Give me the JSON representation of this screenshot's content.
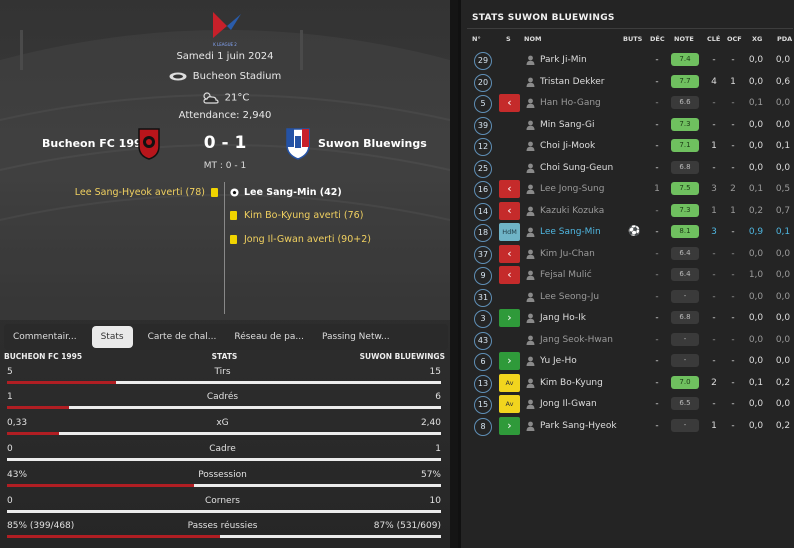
{
  "match": {
    "date": "Samedi 1 juin 2024",
    "stadium": "Bucheon Stadium",
    "temperature": "21°C",
    "attendance": "Attendance: 2,940",
    "home_team": "Bucheon FC 1995",
    "away_team": "Suwon Bluewings",
    "score": "0 - 1",
    "halftime": "MT : 0 - 1",
    "league_logo_text": "K LEAGUE 2"
  },
  "events": {
    "home": [
      {
        "text": "Lee Sang-Hyeok averti (78)",
        "type": "yellow"
      }
    ],
    "away": [
      {
        "text": "Lee Sang-Min (42)",
        "type": "goal"
      },
      {
        "text": "Kim Bo-Kyung averti (76)",
        "type": "yellow"
      },
      {
        "text": "Jong Il-Gwan averti (90+2)",
        "type": "yellow"
      }
    ]
  },
  "tabs": [
    "Commentair...",
    "Stats",
    "Carte de chal...",
    "Réseau de pa...",
    "Passing Netw..."
  ],
  "active_tab": "Stats",
  "stats_header": {
    "home": "BUCHEON FC 1995",
    "center": "STATS",
    "away": "SUWON BLUEWINGS"
  },
  "stats": [
    {
      "label": "Tirs",
      "home": "5",
      "away": "15",
      "home_share": 0.25
    },
    {
      "label": "Cadrés",
      "home": "1",
      "away": "6",
      "home_share": 0.143
    },
    {
      "label": "xG",
      "home": "0,33",
      "away": "2,40",
      "home_share": 0.12
    },
    {
      "label": "Cadre",
      "home": "0",
      "away": "1",
      "home_share": 0.0
    },
    {
      "label": "Possession",
      "home": "43%",
      "away": "57%",
      "home_share": 0.43
    },
    {
      "label": "Corners",
      "home": "0",
      "away": "10",
      "home_share": 0.0
    },
    {
      "label": "Passes réussies",
      "home": "85% (399/468)",
      "away": "87% (531/609)",
      "home_share": 0.49
    }
  ],
  "right_panel": {
    "title": "STATS SUWON BLUEWINGS",
    "columns": [
      "N°",
      "S",
      "NOM",
      "BUTS",
      "DÉC",
      "NOTE",
      "CLÉ",
      "OCF",
      "XG",
      "PDA"
    ]
  },
  "players": [
    {
      "num": "29",
      "sub": "",
      "name": "Park Ji-Min",
      "goals": "",
      "dec": "-",
      "rating": "7.4",
      "rating_color": "green",
      "key": "-",
      "ocf": "-",
      "xg": "0,0",
      "pda": "0,0",
      "dim": false
    },
    {
      "num": "20",
      "sub": "",
      "name": "Tristan Dekker",
      "goals": "",
      "dec": "-",
      "rating": "7.7",
      "rating_color": "green",
      "key": "4",
      "ocf": "1",
      "xg": "0,0",
      "pda": "0,6",
      "dim": false
    },
    {
      "num": "5",
      "sub": "out",
      "name": "Han Ho-Gang",
      "goals": "",
      "dec": "-",
      "rating": "6.6",
      "rating_color": "grey",
      "key": "-",
      "ocf": "-",
      "xg": "0,1",
      "pda": "0,0",
      "dim": true
    },
    {
      "num": "39",
      "sub": "",
      "name": "Min Sang-Gi",
      "goals": "",
      "dec": "-",
      "rating": "7.3",
      "rating_color": "green",
      "key": "-",
      "ocf": "-",
      "xg": "0,0",
      "pda": "0,0",
      "dim": false
    },
    {
      "num": "12",
      "sub": "",
      "name": "Choi Ji-Mook",
      "goals": "",
      "dec": "-",
      "rating": "7.1",
      "rating_color": "green",
      "key": "1",
      "ocf": "-",
      "xg": "0,0",
      "pda": "0,1",
      "dim": false
    },
    {
      "num": "25",
      "sub": "",
      "name": "Choi Sung-Geun",
      "goals": "",
      "dec": "-",
      "rating": "6.8",
      "rating_color": "grey",
      "key": "-",
      "ocf": "-",
      "xg": "0,0",
      "pda": "0,0",
      "dim": false
    },
    {
      "num": "16",
      "sub": "out",
      "name": "Lee Jong-Sung",
      "goals": "",
      "dec": "1",
      "rating": "7.5",
      "rating_color": "green",
      "key": "3",
      "ocf": "2",
      "xg": "0,1",
      "pda": "0,5",
      "dim": true
    },
    {
      "num": "14",
      "sub": "out",
      "name": "Kazuki Kozuka",
      "goals": "",
      "dec": "-",
      "rating": "7.3",
      "rating_color": "green",
      "key": "1",
      "ocf": "1",
      "xg": "0,2",
      "pda": "0,7",
      "dim": true
    },
    {
      "num": "18",
      "sub": "hdm",
      "sub_text": "HdM",
      "name": "Lee Sang-Min",
      "goals": "⚽",
      "dec": "-",
      "rating": "8.1",
      "rating_color": "green",
      "key": "3",
      "ocf": "-",
      "xg": "0,9",
      "pda": "0,1",
      "dim": false,
      "motm": true
    },
    {
      "num": "37",
      "sub": "out",
      "name": "Kim Ju-Chan",
      "goals": "",
      "dec": "-",
      "rating": "6.4",
      "rating_color": "grey",
      "key": "-",
      "ocf": "-",
      "xg": "0,0",
      "pda": "0,0",
      "dim": true
    },
    {
      "num": "9",
      "sub": "out",
      "name": "Fejsal Mulić",
      "goals": "",
      "dec": "-",
      "rating": "6.4",
      "rating_color": "grey",
      "key": "-",
      "ocf": "-",
      "xg": "1,0",
      "pda": "0,0",
      "dim": true
    },
    {
      "num": "31",
      "sub": "",
      "name": "Lee Seong-Ju",
      "goals": "",
      "dec": "-",
      "rating": "-",
      "rating_color": "grey",
      "key": "-",
      "ocf": "-",
      "xg": "0,0",
      "pda": "0,0",
      "dim": true
    },
    {
      "num": "3",
      "sub": "in",
      "name": "Jang Ho-Ik",
      "goals": "",
      "dec": "-",
      "rating": "6.8",
      "rating_color": "grey",
      "key": "-",
      "ocf": "-",
      "xg": "0,0",
      "pda": "0,0",
      "dim": false
    },
    {
      "num": "43",
      "sub": "",
      "name": "Jang Seok-Hwan",
      "goals": "",
      "dec": "-",
      "rating": "-",
      "rating_color": "grey",
      "key": "-",
      "ocf": "-",
      "xg": "0,0",
      "pda": "0,0",
      "dim": true
    },
    {
      "num": "6",
      "sub": "in",
      "name": "Yu Je-Ho",
      "goals": "",
      "dec": "-",
      "rating": "-",
      "rating_color": "grey",
      "key": "-",
      "ocf": "-",
      "xg": "0,0",
      "pda": "0,0",
      "dim": false
    },
    {
      "num": "13",
      "sub": "av",
      "sub_text": "Av",
      "name": "Kim Bo-Kyung",
      "goals": "",
      "dec": "-",
      "rating": "7.0",
      "rating_color": "green",
      "key": "2",
      "ocf": "-",
      "xg": "0,1",
      "pda": "0,2",
      "dim": false
    },
    {
      "num": "15",
      "sub": "av",
      "sub_text": "Av",
      "name": "Jong Il-Gwan",
      "goals": "",
      "dec": "-",
      "rating": "6.5",
      "rating_color": "grey",
      "key": "-",
      "ocf": "-",
      "xg": "0,0",
      "pda": "0,0",
      "dim": false
    },
    {
      "num": "8",
      "sub": "in",
      "name": "Park Sang-Hyeok",
      "goals": "",
      "dec": "-",
      "rating": "-",
      "rating_color": "grey",
      "key": "1",
      "ocf": "-",
      "xg": "0,0",
      "pda": "0,2",
      "dim": false
    }
  ],
  "colors": {
    "home_bar": "#b11e23",
    "rating_green": "#6fc05f",
    "sub_out": "#c52b2b",
    "sub_in": "#2f9a3a",
    "motm": "#4fb6e0"
  }
}
